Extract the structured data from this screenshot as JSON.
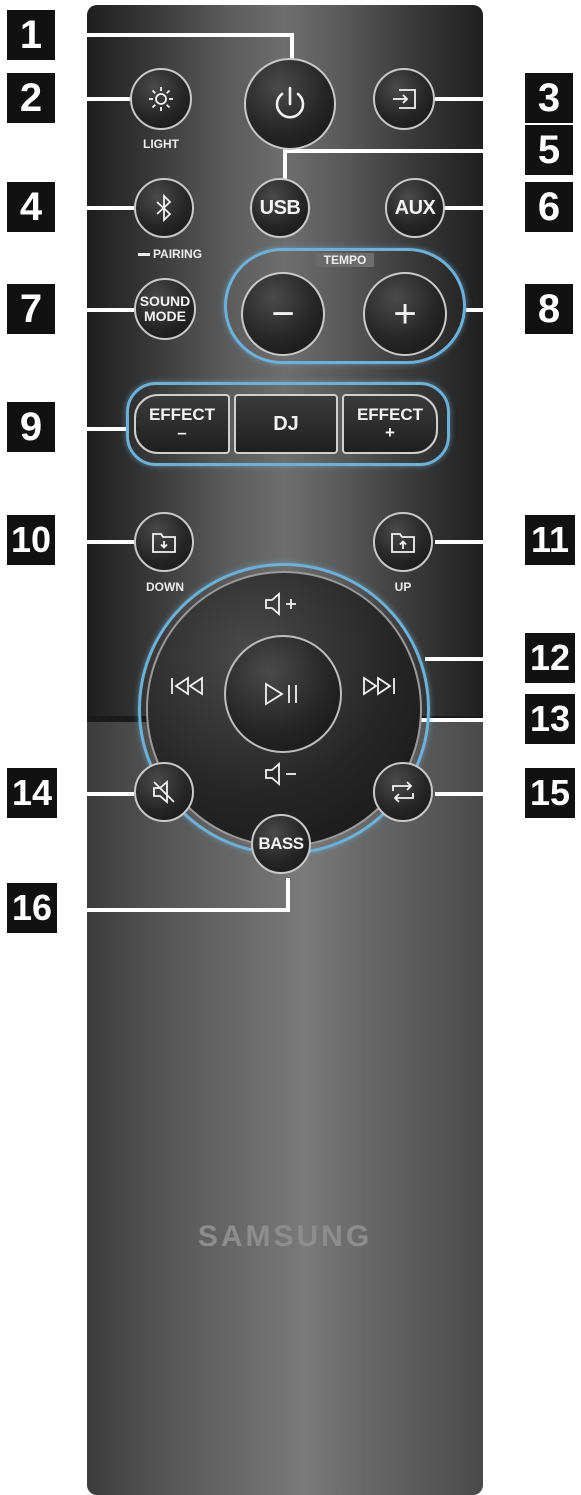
{
  "brand": "SAMSUNG",
  "callouts": [
    "1",
    "2",
    "3",
    "4",
    "5",
    "6",
    "7",
    "8",
    "9",
    "10",
    "11",
    "12",
    "13",
    "14",
    "15",
    "16"
  ],
  "labels": {
    "light": "LIGHT",
    "pairing": "PAIRING",
    "tempo": "TEMPO",
    "down": "DOWN",
    "up": "UP"
  },
  "buttons": {
    "usb": "USB",
    "aux": "AUX",
    "sound_mode_1": "SOUND",
    "sound_mode_2": "MODE",
    "effect": "EFFECT",
    "effect_minus_sign": "–",
    "effect_plus_sign": "+",
    "dj": "DJ",
    "bass": "BASS",
    "tempo_minus": "−",
    "tempo_plus": "+"
  },
  "icons": {
    "power": "power-icon",
    "light": "brightness-icon",
    "input": "input-source-icon",
    "bluetooth": "bluetooth-icon",
    "folder_down": "folder-down-icon",
    "folder_up": "folder-up-icon",
    "volume_up": "volume-up-icon",
    "volume_down": "volume-down-icon",
    "previous": "skip-previous-icon",
    "next": "skip-next-icon",
    "play_pause": "play-pause-icon",
    "mute": "mute-icon",
    "repeat": "repeat-icon"
  },
  "colors": {
    "highlight_ring": "#6fb0d9",
    "remote_body": "#4a4a4a",
    "callout_box": "#111111"
  }
}
